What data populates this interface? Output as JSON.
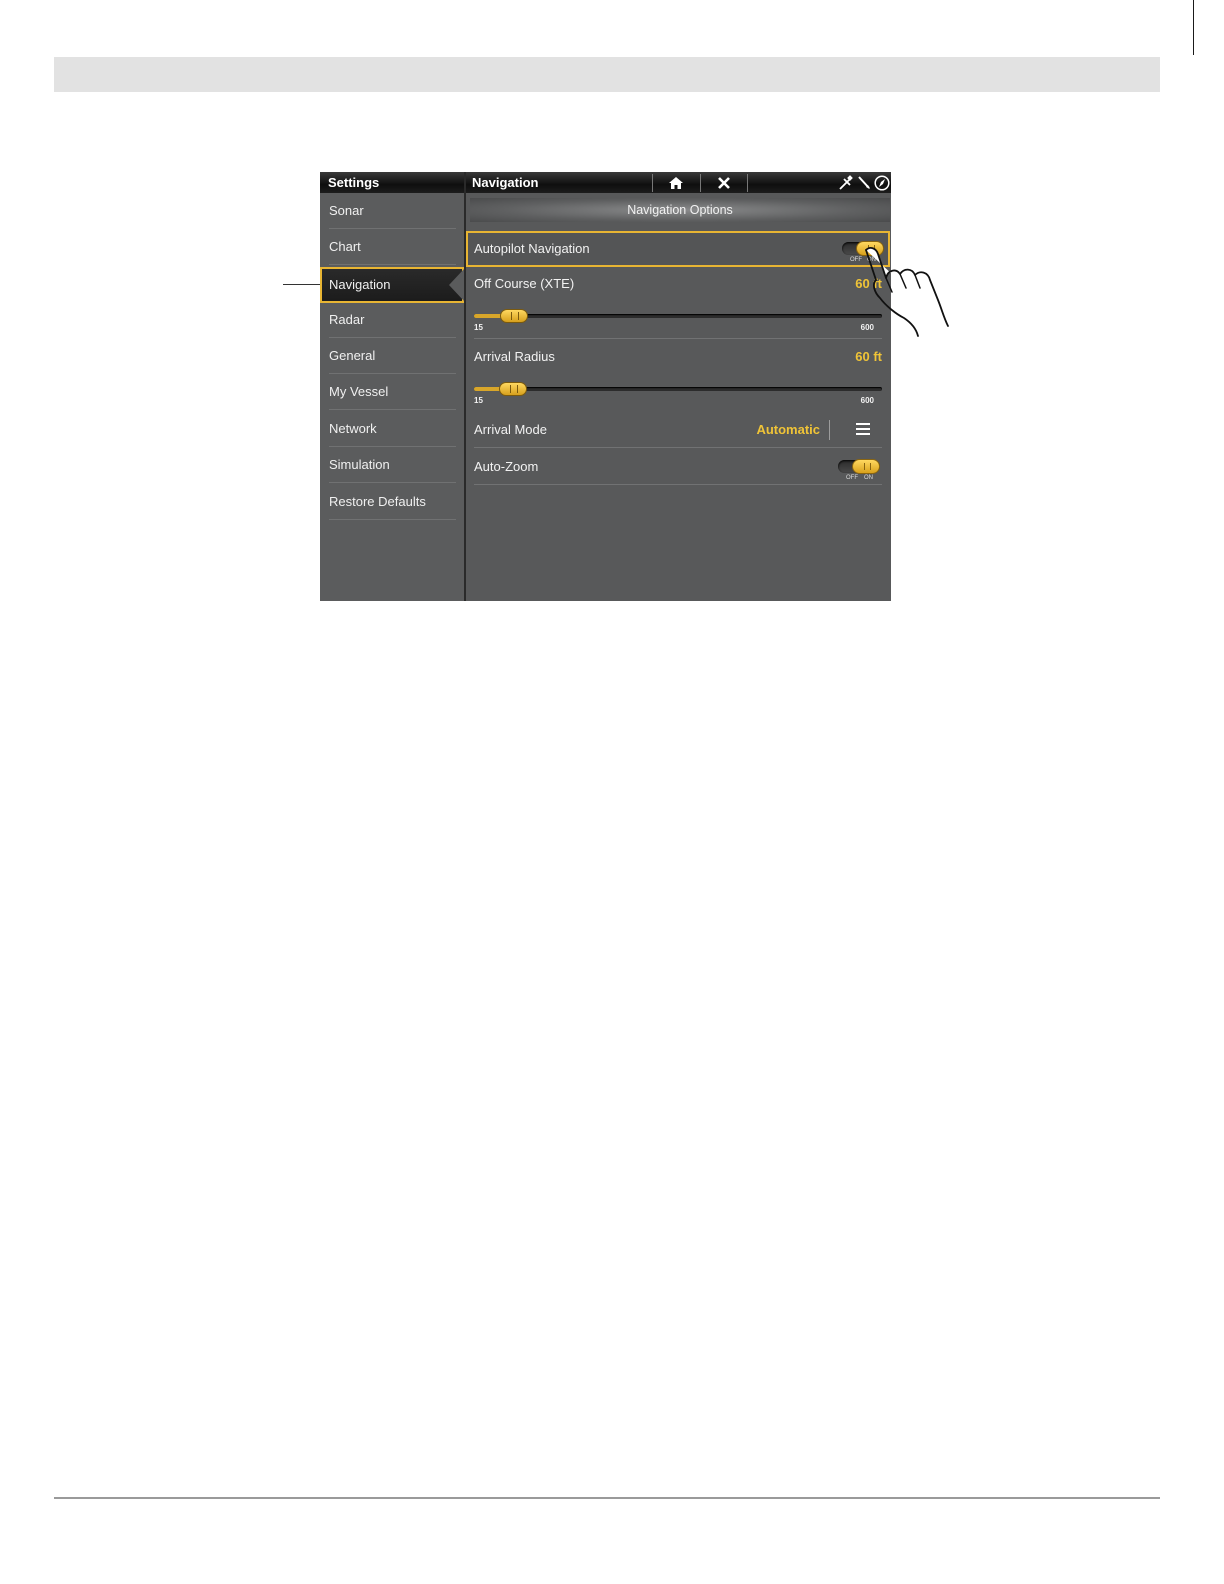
{
  "sidebar": {
    "title": "Settings",
    "items": [
      {
        "label": "Sonar"
      },
      {
        "label": "Chart"
      },
      {
        "label": "Navigation"
      },
      {
        "label": "Radar"
      },
      {
        "label": "General"
      },
      {
        "label": "My Vessel"
      },
      {
        "label": "Network"
      },
      {
        "label": "Simulation"
      },
      {
        "label": "Restore Defaults"
      }
    ],
    "active_index": 2
  },
  "topbar": {
    "title": "Navigation",
    "home_icon": "home-icon",
    "close_icon": "close-icon",
    "status_icons": [
      "gps-icon",
      "satellite-icon",
      "compass-icon"
    ]
  },
  "panel": {
    "section_title": "Navigation Options",
    "autopilot": {
      "label": "Autopilot Navigation",
      "toggle_off": "OFF",
      "toggle_on": "ON",
      "state": "on"
    },
    "off_course": {
      "label": "Off Course (XTE)",
      "value": "60 ft",
      "min": "15",
      "max": "600",
      "current": 60
    },
    "arrival_radius": {
      "label": "Arrival Radius",
      "value": "60 ft",
      "min": "15",
      "max": "600",
      "current": 60
    },
    "arrival_mode": {
      "label": "Arrival Mode",
      "value": "Automatic",
      "menu_icon": "menu-icon"
    },
    "auto_zoom": {
      "label": "Auto-Zoom",
      "toggle_off": "OFF",
      "toggle_on": "ON",
      "state": "on"
    }
  },
  "colors": {
    "accent": "#e8b533",
    "value_text": "#f0c437",
    "panel_bg": "#58595a"
  }
}
